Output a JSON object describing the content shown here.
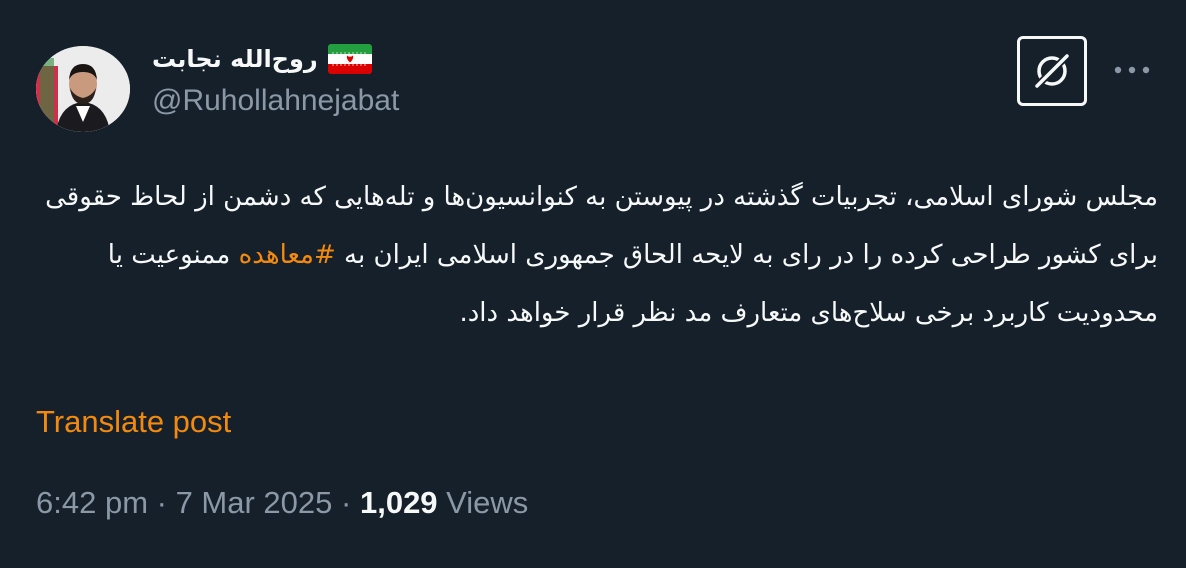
{
  "author": {
    "display_name": "روح‌الله نجابت",
    "handle": "@Ruhollahnejabat"
  },
  "post": {
    "text_before_hashtag": "مجلس شورای اسلامی، تجربیات گذشته در پیوستن به کنوانسیون‌ها و تله‌هایی که دشمن از لحاظ حقوقی برای کشور طراحی کرده را در رای به لایحه الحاق جمهوری اسلامی ایران به ",
    "hashtag": "#معاهده",
    "text_after_hashtag": " ممنوعیت یا محدودیت کاربرد برخی سلاح‌های متعارف مد نظر قرار خواهد داد."
  },
  "translate_label": "Translate post",
  "meta": {
    "time": "6:42 pm",
    "separator": " · ",
    "date": "7 Mar 2025",
    "views_count": "1,029",
    "views_label": " Views"
  },
  "colors": {
    "background": "#15202b",
    "accent": "#f38a0e",
    "secondary_text": "#8b98a5"
  },
  "icons": {
    "flag": "iran-flag-icon",
    "grok": "grok-icon",
    "more": "more-dots-icon"
  }
}
